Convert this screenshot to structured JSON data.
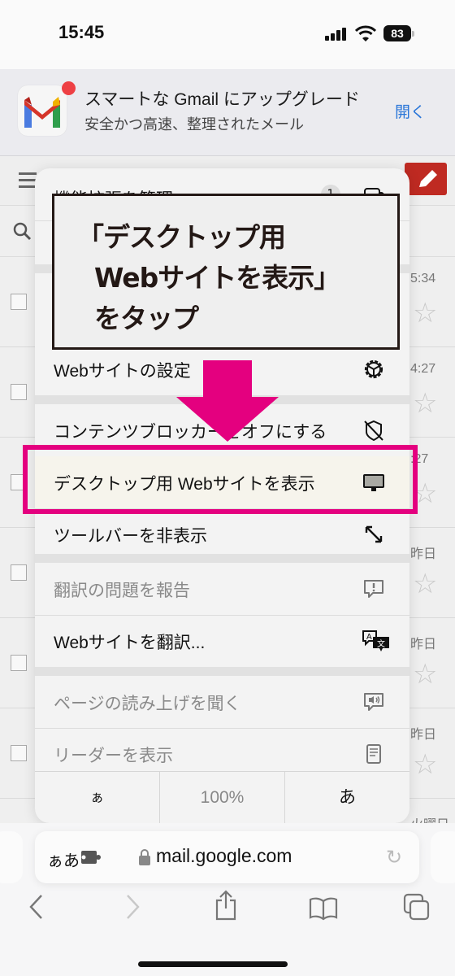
{
  "status_bar": {
    "time": "15:45",
    "battery": "83"
  },
  "banner": {
    "title": "スマートな Gmail にアップグレード",
    "subtitle": "安全かつ高速、整理されたメール",
    "open_label": "開く"
  },
  "mail_rows": [
    {
      "time": "5:34"
    },
    {
      "time": "4:27"
    },
    {
      "time": ":27"
    },
    {
      "time": "昨日"
    },
    {
      "time": "昨日"
    },
    {
      "time": "昨日"
    },
    {
      "time": "火曜日"
    }
  ],
  "menu": {
    "items": [
      {
        "label": "機能拡張を管理",
        "badge": "1",
        "icon": "extension-icon"
      },
      {
        "label": "Webサイトの設定",
        "icon": "gear-icon"
      },
      {
        "label": "コンテンツブロッカーをオフにする",
        "icon": "shield-slash-icon"
      },
      {
        "label": "デスクトップ用 Webサイトを表示",
        "icon": "desktop-icon"
      },
      {
        "label": "ツールバーを非表示",
        "icon": "expand-arrows-icon"
      },
      {
        "label": "翻訳の問題を報告",
        "icon": "exclamation-bubble-icon"
      },
      {
        "label": "Webサイトを翻訳...",
        "icon": "translate-icon"
      },
      {
        "label": "ページの読み上げを聞く",
        "icon": "speaker-bubble-icon"
      },
      {
        "label": "リーダーを表示",
        "icon": "reader-doc-icon"
      }
    ],
    "zoom": {
      "smaller": "ぁ",
      "level": "100%",
      "larger": "あ"
    }
  },
  "annotation": {
    "text": "「デスクトップ用\n  Webサイトを表示」\n  をタップ",
    "accent_color": "#e4007f"
  },
  "address_bar": {
    "aa_label": "ぁあ",
    "url": "mail.google.com"
  }
}
